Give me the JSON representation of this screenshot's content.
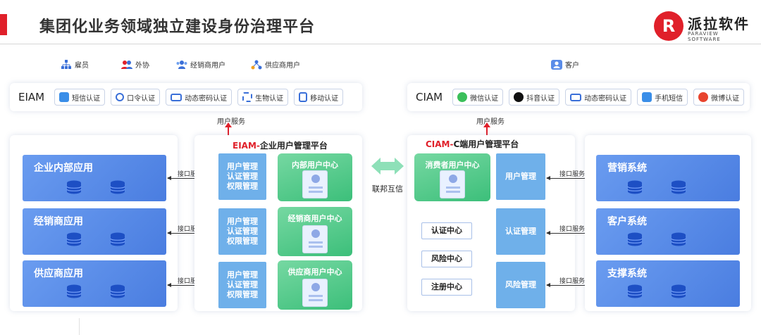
{
  "header": {
    "title": "集团化业务领域独立建设身份治理平台",
    "logo_mark": "R",
    "logo_text": "派拉软件",
    "logo_sub": "PARAVIEW SOFTWARE"
  },
  "user_types_left": [
    "雇员",
    "外协",
    "经销商用户",
    "供应商用户"
  ],
  "user_types_right": [
    "客户"
  ],
  "eiam_bar": {
    "title": "EIAM",
    "chips": [
      "短信认证",
      "口令认证",
      "动态密码认证",
      "生物认证",
      "移动认证"
    ]
  },
  "ciam_bar": {
    "title": "CIAM",
    "chips": [
      "微信认证",
      "抖音认证",
      "动态密码认证",
      "手机短信",
      "微博认证"
    ]
  },
  "user_service": "用户服务",
  "left_apps": [
    "企业内部应用",
    "经销商应用",
    "供应商应用"
  ],
  "interface_label": "接口服务",
  "eiam_platform": {
    "title_prefix": "EIAM-",
    "title_rest": "企业用户管理平台",
    "mgmt_blocks": [
      [
        "用户管理",
        "认证管理",
        "权限管理"
      ],
      [
        "用户管理",
        "认证管理",
        "权限管理"
      ],
      [
        "用户管理",
        "认证管理",
        "权限管理"
      ]
    ],
    "centers": [
      "内部用户中心",
      "经销商用户中心",
      "供应商用户中心"
    ]
  },
  "federation_label": "联邦互信",
  "ciam_platform": {
    "title_prefix": "CIAM-",
    "title_rest": "C端用户管理平台",
    "consumer_center": "消费者用户中心",
    "outline_items": [
      "认证中心",
      "风险中心",
      "注册中心"
    ],
    "mgmt_items": [
      "用户管理",
      "认证管理",
      "风险管理"
    ]
  },
  "right_systems": [
    "营销系统",
    "客户系统",
    "支撑系统"
  ],
  "colors": {
    "accent_red": "#e0202a",
    "app_blue": "#5a8ce8",
    "mgmt_blue": "#6fb0ea",
    "center_green": "#4cc585"
  }
}
